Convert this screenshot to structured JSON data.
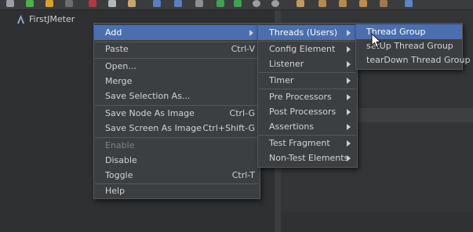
{
  "tree": {
    "root_label": "FirstJMeter"
  },
  "context_menu": {
    "add": "Add",
    "paste": "Paste",
    "paste_shortcut": "Ctrl-V",
    "open": "Open...",
    "merge": "Merge",
    "save_selection_as": "Save Selection As...",
    "save_node_as_image": "Save Node As Image",
    "save_node_as_image_shortcut": "Ctrl-G",
    "save_screen_as_image": "Save Screen As Image",
    "save_screen_as_image_shortcut": "Ctrl+Shift-G",
    "enable": "Enable",
    "disable": "Disable",
    "toggle": "Toggle",
    "toggle_shortcut": "Ctrl-T",
    "help": "Help"
  },
  "add_submenu": {
    "threads_users": "Threads (Users)",
    "config_element": "Config Element",
    "listener": "Listener",
    "timer": "Timer",
    "pre_processors": "Pre Processors",
    "post_processors": "Post Processors",
    "assertions": "Assertions",
    "test_fragment": "Test Fragment",
    "non_test_elements": "Non-Test Elements"
  },
  "threads_submenu": {
    "thread_group": "Thread Group",
    "setup_thread_group": "setUp Thread Group",
    "teardown_thread_group": "tearDown Thread Group"
  },
  "colors": {
    "selection": "#4b6eaf",
    "menu_bg": "#3c3f41",
    "pane_bg": "#2e3032"
  }
}
